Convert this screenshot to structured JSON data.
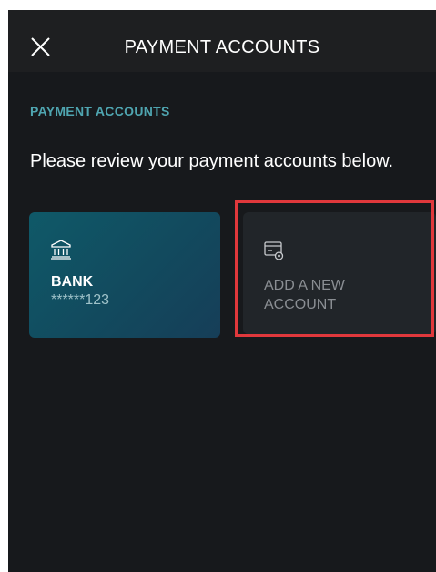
{
  "header": {
    "title": "PAYMENT ACCOUNTS",
    "close_icon": "close-icon"
  },
  "section": {
    "label": "PAYMENT ACCOUNTS",
    "subtitle": "Please review your payment accounts below."
  },
  "accounts": [
    {
      "icon": "bank-icon",
      "name": "BANK",
      "number": "******123"
    }
  ],
  "add_account": {
    "icon": "add-card-icon",
    "label": "ADD A NEW ACCOUNT",
    "highlight_color": "#e0383c"
  },
  "colors": {
    "accent": "#4fa5b0",
    "background": "#17191c",
    "bank_card": "#124a5e",
    "add_card": "#212529"
  }
}
